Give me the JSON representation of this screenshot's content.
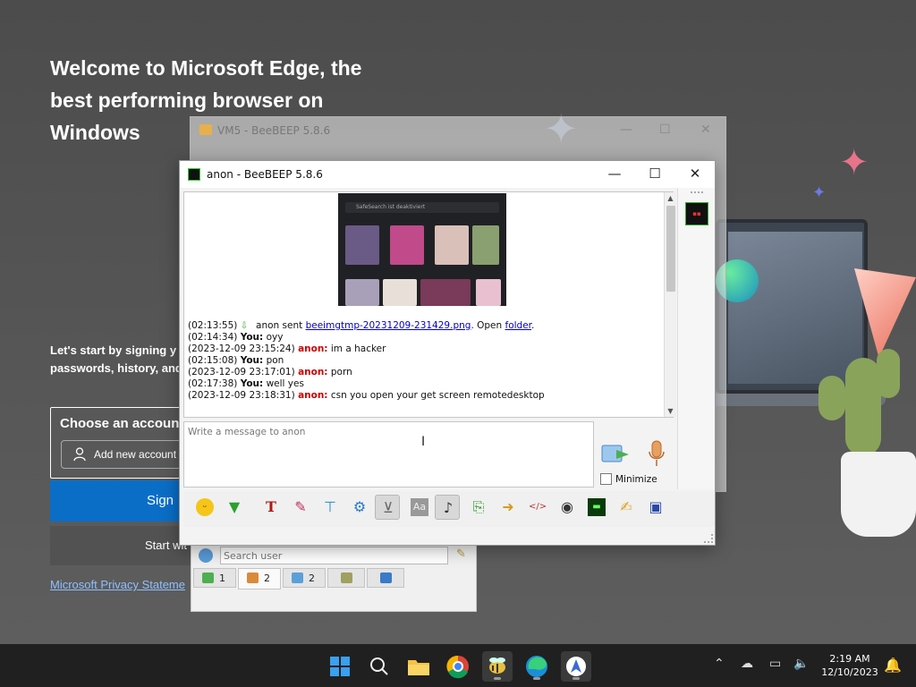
{
  "edge": {
    "welcome_title": "Welcome to Microsoft Edge, the best performing browser on Windows",
    "signin_text_line1": "Let's start by signing y",
    "signin_text_line2": "passwords, history, and",
    "choose_account": "Choose an accoun",
    "add_account": "Add new account",
    "sign_button": "Sign",
    "start_without": "Start wit",
    "privacy": "Microsoft Privacy Stateme"
  },
  "vm5_window": {
    "title": "VM5 - BeeBEEP 5.8.6",
    "search_placeholder": "Search user",
    "tabs": [
      {
        "label": "1",
        "icon": "chat-icon"
      },
      {
        "label": "2",
        "icon": "users-icon"
      },
      {
        "label": "2",
        "icon": "groups-icon"
      },
      {
        "label": "",
        "icon": "network-icon"
      },
      {
        "label": "",
        "icon": "share-icon"
      }
    ]
  },
  "chat_window": {
    "title": "anon - BeeBEEP 5.8.6",
    "thumbnail_caption": "SafeSearch ist deaktiviert",
    "messages": [
      {
        "time": "(02:13:55)",
        "name": "",
        "pre": "anon sent ",
        "link": "beeimgtmp-20231209-231429.png",
        "post": ". Open ",
        "link2": "folder",
        "tail": "."
      },
      {
        "time": "(02:14:34)",
        "name": "You:",
        "text": "oyy"
      },
      {
        "time": "(2023-12-09 23:15:24)",
        "name": "anon:",
        "text": "im a hacker"
      },
      {
        "time": "(02:15:08)",
        "name": "You:",
        "text": "pon"
      },
      {
        "time": "(2023-12-09 23:17:01)",
        "name": "anon:",
        "text": "porn"
      },
      {
        "time": "(02:17:38)",
        "name": "You:",
        "text": "well yes"
      },
      {
        "time": "(2023-12-09 23:18:31)",
        "name": "anon:",
        "text": "csn you open your get screen remotedesktop"
      }
    ],
    "input_placeholder": "Write a message to anon",
    "minimize_label": "Minimize",
    "toolbar_icons": [
      "emoticon-icon",
      "save-chat-icon",
      "font-icon",
      "color-icon",
      "filter-icon",
      "settings-icon",
      "clear-icon",
      "spellcheck-icon",
      "sound-icon",
      "file-icon",
      "send-folder-icon",
      "html-icon",
      "screenshot-icon",
      "terminal-icon",
      "notes-icon",
      "save-icon"
    ]
  },
  "taskbar": {
    "time": "2:19 AM",
    "date": "12/10/2023",
    "apps": [
      "start-icon",
      "search-icon",
      "file-explorer-icon",
      "chrome-icon",
      "beebeep-icon",
      "edge-icon",
      "app-icon"
    ]
  },
  "colors": {
    "accent_blue": "#0a6ec7",
    "anon_name": "#cc0000",
    "link": "#0000cc"
  }
}
